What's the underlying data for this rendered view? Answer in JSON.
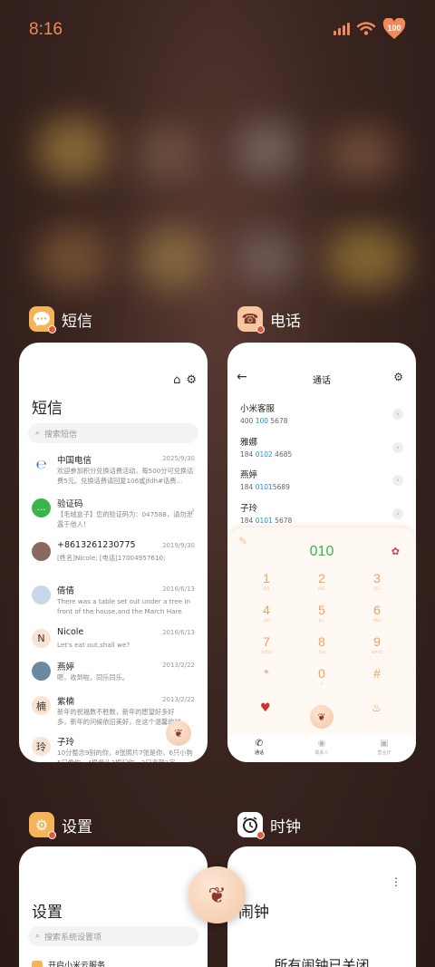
{
  "status_bar": {
    "time": "8:16",
    "battery_level": "100"
  },
  "recents": [
    {
      "app_name": "短信",
      "screen": {
        "title": "短信",
        "search_placeholder": "搜索短信",
        "messages": [
          {
            "name": "中国电信",
            "date": "2025/9/30",
            "preview": "欢迎参加积分兑换话费活动，每500分可兑换话费5元。兑换话费请回复106或jfdh#话费..."
          },
          {
            "name": "验证码",
            "date": "",
            "preview": "【毛绒盒子】您的验证码为：047588，请勿泄露于他人！"
          },
          {
            "name": "+8613261230775",
            "date": "2019/9/30",
            "preview": "[姓名]Nicole; [电话]17004957610;"
          },
          {
            "name": "倩倩",
            "date": "2016/6/13",
            "preview": "There was a table set out under a tree in front of the house,and the March Hare an..."
          },
          {
            "name": "Nicole",
            "avatar_letter": "N",
            "date": "2016/6/13",
            "preview": "Let's eat out,shall we?"
          },
          {
            "name": "燕婷",
            "date": "2013/2/22",
            "preview": "嗯，收到啦，同乐同乐。"
          },
          {
            "name": "紫楠",
            "avatar_letter": "楠",
            "date": "2013/2/22",
            "preview": "新年的祝福数不胜数，新年的愿望好多好多，新年的问候依旧美好，在这个温馨的时刻..."
          },
          {
            "name": "子玲",
            "avatar_letter": "玲",
            "date": "",
            "preview": "10分整念9别的你，8张照片7张是你，6只小狗5只像你，4根骨头3根归你，2只喜鹊1定..."
          }
        ]
      }
    },
    {
      "app_name": "电话",
      "screen": {
        "title": "通话",
        "contacts": [
          {
            "name": "小米客服",
            "num_pre": "400 ",
            "num_hl": "100",
            "num_post": " 5678"
          },
          {
            "name": "雅娜",
            "num_pre": "184 ",
            "num_hl": "0102",
            "num_post": " 4685"
          },
          {
            "name": "燕婷",
            "num_pre": "184 ",
            "num_hl": "0101",
            "num_post": "5689"
          },
          {
            "name": "子玲",
            "num_pre": "184 ",
            "num_hl": "0101",
            "num_post": " 5678"
          }
        ],
        "dial_input": "010",
        "keys": [
          {
            "digit": "1",
            "letters": "QQ"
          },
          {
            "digit": "2",
            "letters": "ABC"
          },
          {
            "digit": "3",
            "letters": "DEF"
          },
          {
            "digit": "4",
            "letters": "GHI"
          },
          {
            "digit": "5",
            "letters": "JKL"
          },
          {
            "digit": "6",
            "letters": "MNO"
          },
          {
            "digit": "7",
            "letters": "PQRS"
          },
          {
            "digit": "8",
            "letters": "TUV"
          },
          {
            "digit": "9",
            "letters": "WXYZ"
          },
          {
            "digit": "*",
            "letters": ""
          },
          {
            "digit": "0",
            "letters": "+"
          },
          {
            "digit": "#",
            "letters": ""
          }
        ],
        "tabs": [
          "通话",
          "联系人",
          "营业厅"
        ]
      }
    },
    {
      "app_name": "设置",
      "screen": {
        "title": "设置",
        "search_placeholder": "搜索系统设置项",
        "first_item": "开启小米云服务"
      }
    },
    {
      "app_name": "时钟",
      "screen": {
        "title": "闹钟",
        "empty_text": "所有闹钟已关闭"
      }
    }
  ],
  "colors": {
    "accent": "#f08a5a",
    "green": "#3ab54a",
    "blue": "#1e8fe0"
  }
}
